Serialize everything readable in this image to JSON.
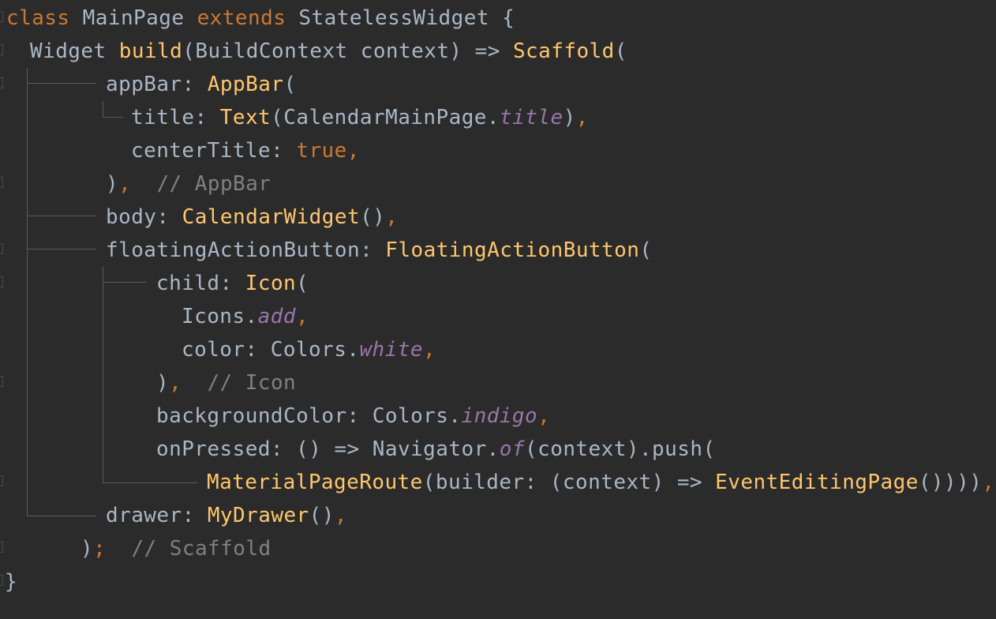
{
  "editor": {
    "language": "dart",
    "theme_colors": {
      "background": "#2b2b2b",
      "plain": "#a9b7c6",
      "keyword": "#cc7832",
      "function": "#ffc66d",
      "static_member": "#9876aa",
      "comment": "#808080",
      "guide": "#5a5a5a"
    },
    "lines": [
      [
        [
          "kw",
          "class"
        ],
        [
          "pl",
          " MainPage "
        ],
        [
          "kw",
          "extends"
        ],
        [
          "pl",
          " StatelessWidget {"
        ]
      ],
      [
        [
          "pl",
          "Widget "
        ],
        [
          "fn",
          "build"
        ],
        [
          "pl",
          "(BuildContext context) => "
        ],
        [
          "fn",
          "Scaffold"
        ],
        [
          "pl",
          "("
        ]
      ],
      [
        [
          "pl",
          "appBar: "
        ],
        [
          "fn",
          "AppBar"
        ],
        [
          "pl",
          "("
        ]
      ],
      [
        [
          "pl",
          "title: "
        ],
        [
          "fn",
          "Text"
        ],
        [
          "pl",
          "(CalendarMainPage."
        ],
        [
          "st",
          "title"
        ],
        [
          "pl",
          ")"
        ],
        [
          "p",
          ","
        ]
      ],
      [
        [
          "pl",
          "centerTitle: "
        ],
        [
          "kw",
          "true"
        ],
        [
          "p",
          ","
        ]
      ],
      [
        [
          "pl",
          ")"
        ],
        [
          "p",
          ","
        ],
        [
          "pl",
          "  "
        ],
        [
          "cm",
          "// AppBar"
        ]
      ],
      [
        [
          "pl",
          "body: "
        ],
        [
          "fn",
          "CalendarWidget"
        ],
        [
          "pl",
          "()"
        ],
        [
          "p",
          ","
        ]
      ],
      [
        [
          "pl",
          "floatingActionButton: "
        ],
        [
          "fn",
          "FloatingActionButton"
        ],
        [
          "pl",
          "("
        ]
      ],
      [
        [
          "pl",
          "child: "
        ],
        [
          "fn",
          "Icon"
        ],
        [
          "pl",
          "("
        ]
      ],
      [
        [
          "pl",
          "Icons."
        ],
        [
          "st",
          "add"
        ],
        [
          "p",
          ","
        ]
      ],
      [
        [
          "pl",
          "color: Colors."
        ],
        [
          "st",
          "white"
        ],
        [
          "p",
          ","
        ]
      ],
      [
        [
          "pl",
          ")"
        ],
        [
          "p",
          ","
        ],
        [
          "pl",
          "  "
        ],
        [
          "cm",
          "// Icon"
        ]
      ],
      [
        [
          "pl",
          "backgroundColor: Colors."
        ],
        [
          "st",
          "indigo"
        ],
        [
          "p",
          ","
        ]
      ],
      [
        [
          "pl",
          "onPressed: () => Navigator."
        ],
        [
          "st",
          "of"
        ],
        [
          "pl",
          "(context).push("
        ]
      ],
      [
        [
          "fn",
          "MaterialPageRoute"
        ],
        [
          "pl",
          "(builder: (context) => "
        ],
        [
          "fn",
          "EventEditingPage"
        ],
        [
          "pl",
          "()))"
        ],
        [
          "pl",
          ")"
        ],
        [
          "p",
          ","
        ]
      ],
      [
        [
          "pl",
          "drawer: "
        ],
        [
          "fn",
          "MyDrawer"
        ],
        [
          "pl",
          "()"
        ],
        [
          "p",
          ","
        ]
      ],
      [
        [
          "pl",
          ")"
        ],
        [
          "p",
          ";"
        ],
        [
          "pl",
          "  "
        ],
        [
          "cm",
          "// Scaffold"
        ]
      ],
      [
        [
          "pl",
          "}"
        ]
      ]
    ]
  }
}
